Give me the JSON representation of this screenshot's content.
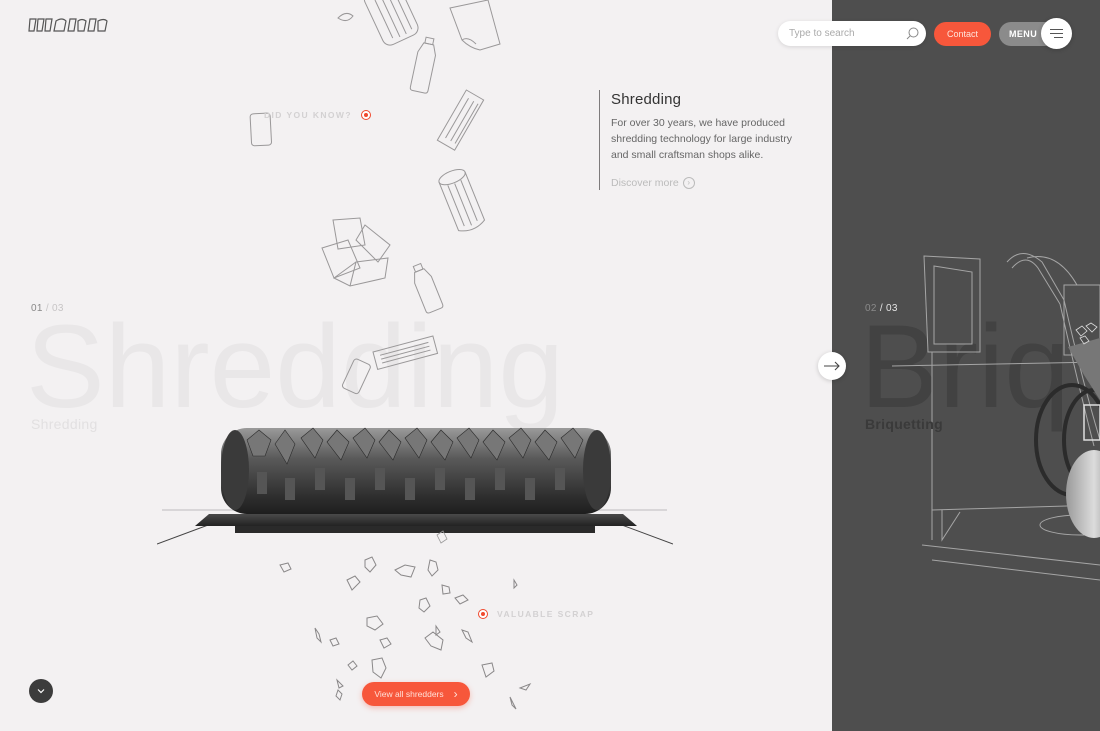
{
  "brand": {
    "logo_text": "wema"
  },
  "header": {
    "search_placeholder": "Type to search",
    "search_value": "",
    "contact_label": "Contact",
    "menu_label": "MENU"
  },
  "colors": {
    "accent": "#f7573b",
    "panel_light": "#f3f1f2",
    "panel_dark": "#4e4e4e"
  },
  "intro": {
    "title": "Shredding",
    "body": "For over 30 years, we have produced shredding technology for large industry and small craftsman shops alike.",
    "discover_label": "Discover more"
  },
  "hotspots": [
    {
      "label": "DID YOU KNOW?"
    },
    {
      "label": "VALUABLE SCRAP"
    }
  ],
  "slides": [
    {
      "index": "01",
      "total": "03",
      "big_word": "Shredding",
      "label": "Shredding"
    },
    {
      "index": "02",
      "total": "03",
      "big_word": "Briq",
      "label": "Briquetting"
    }
  ],
  "actions": {
    "view_all_label": "View all shredders"
  },
  "icons": {
    "search": "search-icon",
    "menu": "hamburger-icon",
    "next": "arrow-right-icon",
    "scroll": "chevron-down-icon",
    "discover": "chevron-right-circle-icon",
    "view_all": "chevron-right-icon"
  }
}
